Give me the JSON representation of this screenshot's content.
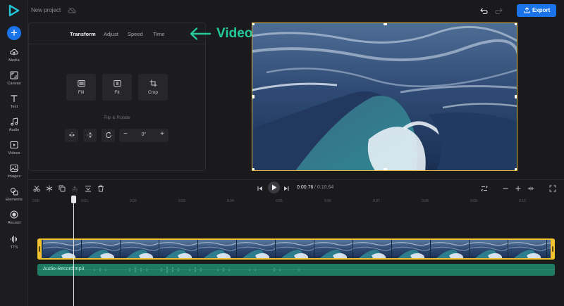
{
  "project": {
    "name": "New project"
  },
  "header": {
    "export_label": "Export"
  },
  "rail": {
    "items": [
      {
        "label": "Media"
      },
      {
        "label": "Canvas"
      },
      {
        "label": "Text"
      },
      {
        "label": "Audio"
      },
      {
        "label": "Videos"
      },
      {
        "label": "Images"
      },
      {
        "label": "Elements"
      },
      {
        "label": "Record"
      },
      {
        "label": "TTS"
      }
    ]
  },
  "panel": {
    "tabs": [
      {
        "label": "Transform",
        "active": true
      },
      {
        "label": "Adjust"
      },
      {
        "label": "Speed"
      },
      {
        "label": "Time"
      }
    ],
    "fit_buttons": [
      {
        "label": "Fill"
      },
      {
        "label": "Fit"
      },
      {
        "label": "Crop"
      }
    ],
    "flip_rotate_title": "Flip & Rotate",
    "rotation_value": "0°"
  },
  "annotation": {
    "text": "Video settings"
  },
  "timeline": {
    "current_time": "0:00.76",
    "total_time": "/ 0:10.64",
    "ruler_ticks": [
      "0:00",
      "0:01",
      "0:02",
      "0:03",
      "0:04",
      "0:05",
      "0:06",
      "0:07",
      "0:08",
      "0:09",
      "0:10"
    ],
    "audio_track_name": "Audio-Record.mp3"
  },
  "colors": {
    "accent": "#1a73e8",
    "annotation": "#23c99a",
    "selection": "#f2c12e",
    "audio": "#1e7a62"
  }
}
